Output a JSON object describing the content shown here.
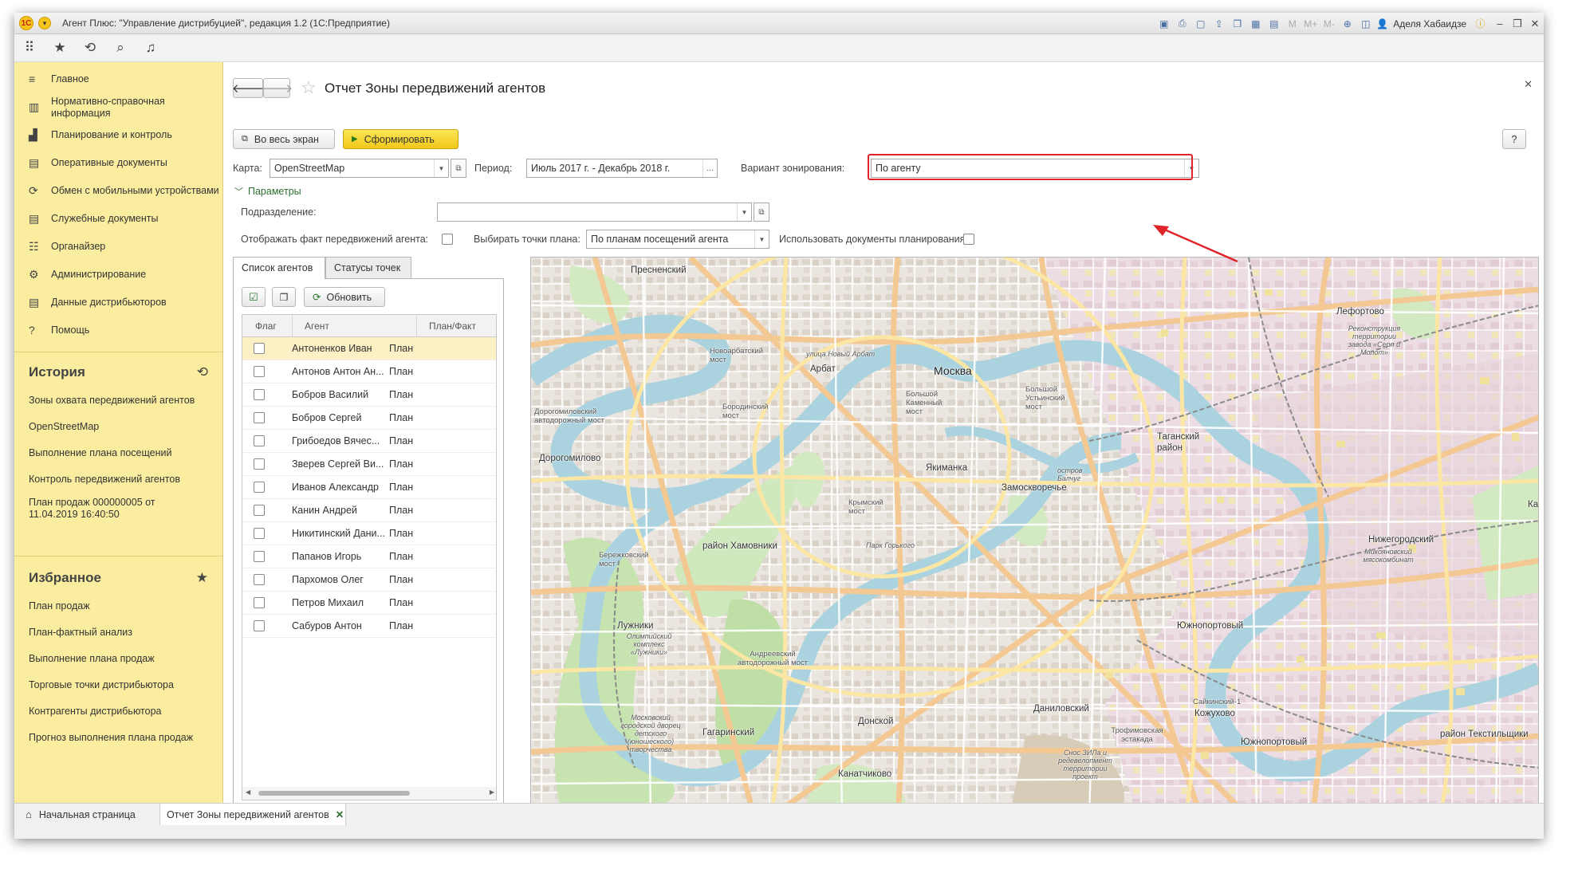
{
  "titlebar": {
    "title": "Агент Плюс: \"Управление дистрибуцией\", редакция 1.2  (1С:Предприятие)",
    "user": "Аделя Хабаидзе",
    "icons": [
      "save-icon",
      "print-icon",
      "preview-icon",
      "upload-icon",
      "copy-icon",
      "calc-icon",
      "calendar-icon",
      "m-icon",
      "mplus-icon",
      "mminus-icon",
      "zoom-icon",
      "panel-icon"
    ]
  },
  "sidebar": {
    "nav": [
      {
        "label": "Главное",
        "icon": "≡"
      },
      {
        "label": "Нормативно-справочная информация",
        "icon": "▥"
      },
      {
        "label": "Планирование и контроль",
        "icon": "▟"
      },
      {
        "label": "Оперативные документы",
        "icon": "▤"
      },
      {
        "label": "Обмен с мобильными устройствами",
        "icon": "⟳"
      },
      {
        "label": "Служебные документы",
        "icon": "▤"
      },
      {
        "label": "Органайзер",
        "icon": "☷"
      },
      {
        "label": "Администрирование",
        "icon": "⚙"
      },
      {
        "label": "Данные дистрибьюторов",
        "icon": "▤"
      },
      {
        "label": "Помощь",
        "icon": "?"
      }
    ],
    "history": {
      "title": "История",
      "items": [
        "Зоны охвата передвижений агентов",
        "OpenStreetMap",
        "Выполнение плана посещений",
        "Контроль передвижений агентов",
        "План продаж 000000005 от 11.04.2019 16:40:50"
      ]
    },
    "favorites": {
      "title": "Избранное",
      "items": [
        "План продаж",
        "План-фактный анализ",
        "Выполнение плана продаж",
        "Торговые точки дистрибьютора",
        "Контрагенты дистрибьютора",
        "Прогноз выполнения плана продаж"
      ]
    }
  },
  "form": {
    "title": "Отчет Зоны передвижений агентов",
    "fullscreen_label": "Во весь экран",
    "generate_label": "Сформировать",
    "help_label": "?",
    "map_label": "Карта:",
    "map_value": "OpenStreetMap",
    "period_label": "Период:",
    "period_value": "Июль 2017 г. - Декабрь 2018 г.",
    "zoning_label": "Вариант зонирования:",
    "zoning_value": "По агенту",
    "params_label": "Параметры",
    "subdivision_label": "Подразделение:",
    "subdivision_value": "",
    "show_fact_label": "Отображать факт передвижений агента:",
    "choose_points_label": "Выбирать точки плана:",
    "choose_points_value": "По планам посещений агента",
    "use_docs_label": "Использовать документы планирования:"
  },
  "tabs": [
    "Список агентов",
    "Статусы точек"
  ],
  "agents": {
    "refresh_label": "Обновить",
    "columns": [
      "Флаг",
      "Агент",
      "План/Факт"
    ],
    "rows": [
      {
        "agent": "Антоненков Иван",
        "plan": "План"
      },
      {
        "agent": "Антонов Антон Ан...",
        "plan": "План"
      },
      {
        "agent": "Бобров Василий",
        "plan": "План"
      },
      {
        "agent": "Бобров Сергей",
        "plan": "План"
      },
      {
        "agent": "Грибоедов Вячес...",
        "plan": "План"
      },
      {
        "agent": "Зверев Сергей Ви...",
        "plan": "План"
      },
      {
        "agent": "Иванов Александр",
        "plan": "План"
      },
      {
        "agent": "Канин Андрей",
        "plan": "План"
      },
      {
        "agent": "Никитинский Дани...",
        "plan": "План"
      },
      {
        "agent": "Папанов Игорь",
        "plan": "План"
      },
      {
        "agent": "Пархомов Олег",
        "plan": "План"
      },
      {
        "agent": "Петров Михаил",
        "plan": "План"
      },
      {
        "agent": "Сабуров Антон",
        "plan": "План"
      }
    ]
  },
  "map": {
    "labels": [
      {
        "t": "Пресненский",
        "c": ""
      },
      {
        "t": "Лефортово",
        "c": ""
      },
      {
        "t": "Москва",
        "c": "big"
      },
      {
        "t": "Новоарбатский мост",
        "c": "sm"
      },
      {
        "t": "Арбат",
        "c": ""
      },
      {
        "t": "улица Новый Арбат",
        "c": "it"
      },
      {
        "t": "Бородинский мост",
        "c": "sm"
      },
      {
        "t": "Большой Каменный мост",
        "c": "sm"
      },
      {
        "t": "Большой Устьинский мост",
        "c": "sm"
      },
      {
        "t": "Дорогомиловский автодорожный мост",
        "c": "sm"
      },
      {
        "t": "Дорогомилово",
        "c": ""
      },
      {
        "t": "Таганский район",
        "c": ""
      },
      {
        "t": "Якиманка",
        "c": ""
      },
      {
        "t": "Замоскворечье",
        "c": ""
      },
      {
        "t": "остров Балчуг",
        "c": "it"
      },
      {
        "t": "Крымский мост",
        "c": "sm"
      },
      {
        "t": "район Хамовники",
        "c": ""
      },
      {
        "t": "Парк Горького",
        "c": "it"
      },
      {
        "t": "Нижегородский",
        "c": ""
      },
      {
        "t": "Бережковский мост",
        "c": "sm"
      },
      {
        "t": "Лужники",
        "c": ""
      },
      {
        "t": "Олимпийский комплекс «Лужники»",
        "c": "it"
      },
      {
        "t": "Южнопортовый",
        "c": ""
      },
      {
        "t": "Андреевский автодорожный мост",
        "c": "sm"
      },
      {
        "t": "Сайкинский-1",
        "c": "sm"
      },
      {
        "t": "Кожухово",
        "c": ""
      },
      {
        "t": "Донской",
        "c": ""
      },
      {
        "t": "Даниловский",
        "c": ""
      },
      {
        "t": "Гагаринский",
        "c": ""
      },
      {
        "t": "Трофимовская эстакада",
        "c": "sm"
      },
      {
        "t": "Южнопортовый",
        "c": ""
      },
      {
        "t": "район Текстильщики",
        "c": ""
      },
      {
        "t": "Канатчиково",
        "c": ""
      },
      {
        "t": "Реконструкция территории завода «Серп и Молот»",
        "c": "it"
      },
      {
        "t": "Микояновский мясокомбинат",
        "c": "it"
      },
      {
        "t": "Снос ЗИЛа и редевелопмент территории проект",
        "c": "it"
      },
      {
        "t": "Московский городской дворец детского (юношеского) творчества",
        "c": "it"
      },
      {
        "t": "Ка",
        "c": ""
      }
    ]
  },
  "taskbar": {
    "home_label": "Начальная страница",
    "active_label": "Отчет Зоны передвижений агентов"
  }
}
